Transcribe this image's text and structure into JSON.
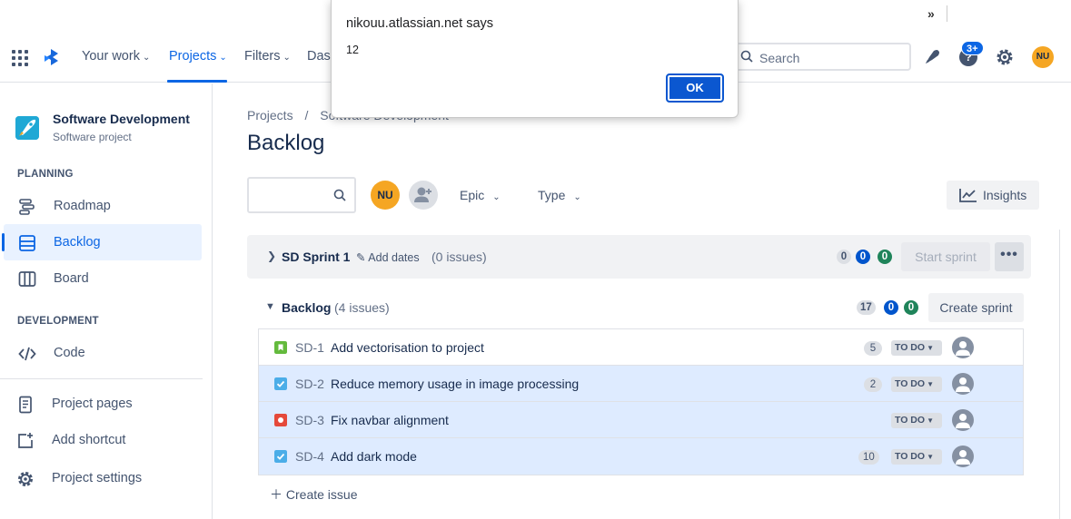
{
  "browser": {
    "more_label": "»"
  },
  "topnav": {
    "items": [
      {
        "label": "Your work",
        "chevron": "⌄"
      },
      {
        "label": "Projects",
        "chevron": "⌄"
      },
      {
        "label": "Filters",
        "chevron": "⌄"
      },
      {
        "label": "Dashboards"
      }
    ],
    "search_placeholder": "Search",
    "help_badge": "3+",
    "avatar_initials": "NU",
    "accent_color": "#0C66E4"
  },
  "sidebar": {
    "project_name": "Software Development",
    "project_type": "Software project",
    "section_planning": "PLANNING",
    "section_development": "DEVELOPMENT",
    "planning_items": [
      {
        "label": "Roadmap",
        "icon": "roadmap-icon"
      },
      {
        "label": "Backlog",
        "icon": "backlog-icon"
      },
      {
        "label": "Board",
        "icon": "board-icon"
      }
    ],
    "dev_items": [
      {
        "label": "Code",
        "icon": "code-icon"
      }
    ],
    "footer_items": [
      {
        "label": "Project pages",
        "icon": "page-icon"
      },
      {
        "label": "Add shortcut",
        "icon": "add-shortcut-icon"
      },
      {
        "label": "Project settings",
        "icon": "gear-icon"
      }
    ]
  },
  "main": {
    "breadcrumb": [
      "Projects",
      "/",
      "Software Development"
    ],
    "title": "Backlog",
    "avatar_initials": "NU",
    "filters": [
      "Epic",
      "Type"
    ],
    "insights_label": "Insights"
  },
  "sprint": {
    "name": "SD Sprint 1",
    "add_dates_label": "Add dates",
    "issue_count": "(0 issues)",
    "counts": [
      "0",
      "0",
      "0"
    ],
    "start_label": "Start sprint",
    "more_label": "•••"
  },
  "backlog": {
    "name": "Backlog",
    "issue_count": "(4 issues)",
    "counts": [
      "17",
      "0",
      "0"
    ],
    "create_sprint_label": "Create sprint",
    "issues": [
      {
        "type": "story",
        "key": "SD-1",
        "summary": "Add vectorisation to project",
        "estimate": "5",
        "status": "TO DO",
        "selected": false
      },
      {
        "type": "task",
        "key": "SD-2",
        "summary": "Reduce memory usage in image processing",
        "estimate": "2",
        "status": "TO DO",
        "selected": true
      },
      {
        "type": "bug",
        "key": "SD-3",
        "summary": "Fix navbar alignment",
        "estimate": "",
        "status": "TO DO",
        "selected": true
      },
      {
        "type": "task",
        "key": "SD-4",
        "summary": "Add dark mode",
        "estimate": "10",
        "status": "TO DO",
        "selected": true
      }
    ],
    "create_issue_label": "Create issue"
  },
  "dialog": {
    "title": "nikouu.atlassian.net says",
    "message": "12",
    "ok_label": "OK"
  }
}
